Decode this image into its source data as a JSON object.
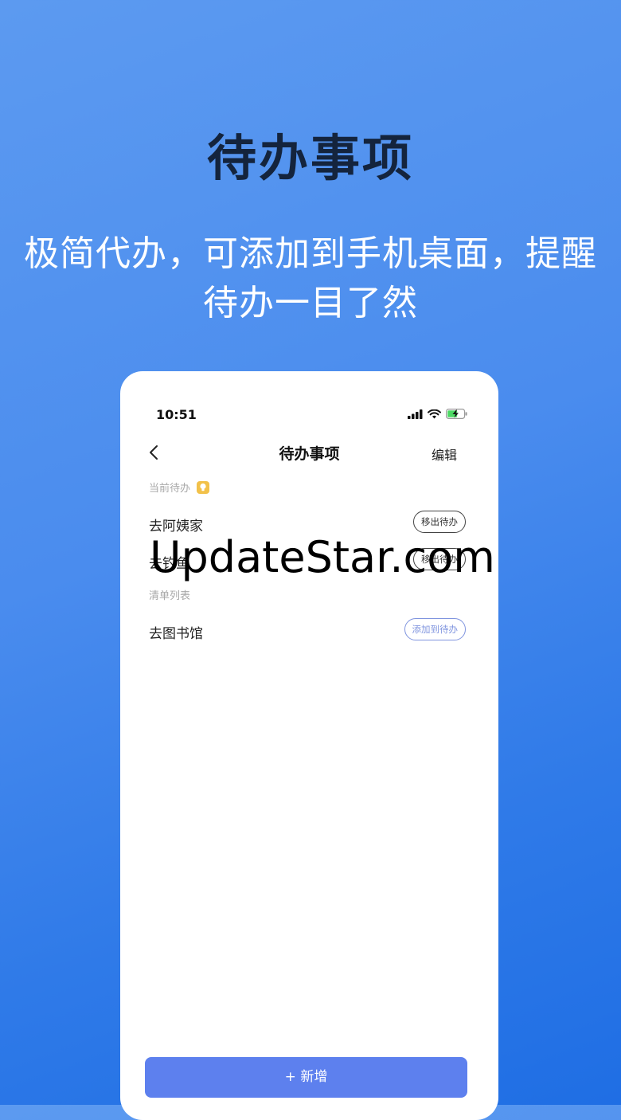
{
  "hero": {
    "title": "待办事项",
    "subtitle_line1": "极简代办，可添加到手机桌面，提醒",
    "subtitle_line2": "待办一目了然"
  },
  "status_bar": {
    "time": "10:51"
  },
  "nav": {
    "title": "待办事项",
    "edit_label": "编辑"
  },
  "current_section": {
    "label": "当前待办",
    "items": [
      {
        "text": "去阿姨家",
        "action": "移出待办"
      },
      {
        "text": "去钓鱼",
        "action": "移出待办"
      }
    ]
  },
  "list_section": {
    "label": "清单列表",
    "items": [
      {
        "text": "去图书馆",
        "action": "添加到待办"
      }
    ]
  },
  "add_button": {
    "label": "+ 新增"
  },
  "watermark": "UpdateStar.com",
  "colors": {
    "background_top": "#5c9af0",
    "background_bottom": "#1f6ee4",
    "primary_button": "#5d80ee",
    "accent_outline": "#7f94df"
  }
}
